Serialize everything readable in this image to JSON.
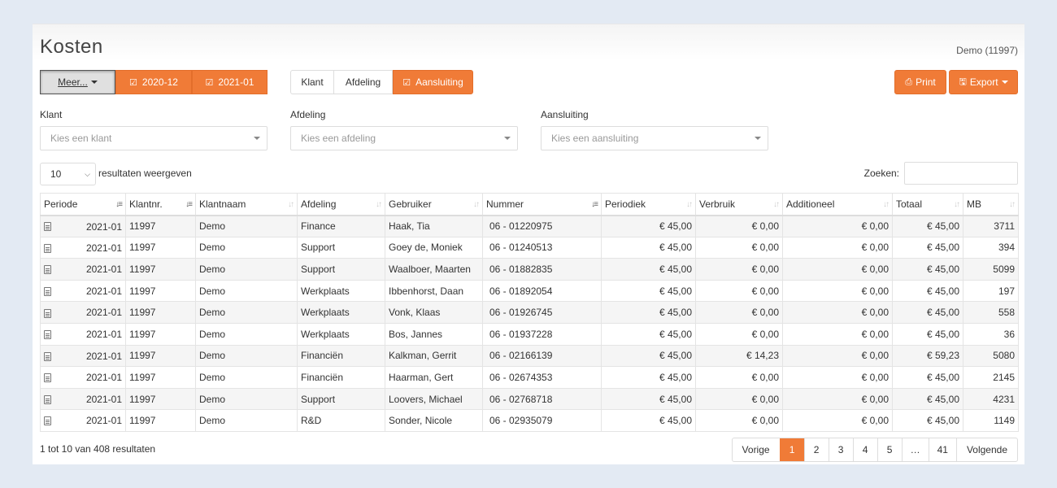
{
  "page": {
    "title": "Kosten",
    "account": "Demo (11997)"
  },
  "toolbar": {
    "more_label": "Meer...",
    "period_buttons": [
      "2020-12",
      "2021-01"
    ],
    "group_buttons": [
      "Klant",
      "Afdeling",
      "Aansluiting"
    ],
    "print_label": "Print",
    "export_label": "Export"
  },
  "filters": {
    "klant": {
      "label": "Klant",
      "placeholder": "Kies een klant"
    },
    "afdeling": {
      "label": "Afdeling",
      "placeholder": "Kies een afdeling"
    },
    "aansluiting": {
      "label": "Aansluiting",
      "placeholder": "Kies een aansluiting"
    }
  },
  "table_controls": {
    "page_length": "10",
    "length_label": "resultaten weergeven",
    "search_label": "Zoeken:"
  },
  "table": {
    "headers": [
      "Periode",
      "Klantnr.",
      "Klantnaam",
      "Afdeling",
      "Gebruiker",
      "Nummer",
      "Periodiek",
      "Verbruik",
      "Additioneel",
      "Totaal",
      "MB"
    ],
    "rows": [
      [
        "2021-01",
        "11997",
        "Demo",
        "Finance",
        "Haak, Tia",
        "06 - 01220975",
        "€ 45,00",
        "€ 0,00",
        "€ 0,00",
        "€ 45,00",
        "3711"
      ],
      [
        "2021-01",
        "11997",
        "Demo",
        "Support",
        "Goey de, Moniek",
        "06 - 01240513",
        "€ 45,00",
        "€ 0,00",
        "€ 0,00",
        "€ 45,00",
        "394"
      ],
      [
        "2021-01",
        "11997",
        "Demo",
        "Support",
        "Waalboer, Maarten",
        "06 - 01882835",
        "€ 45,00",
        "€ 0,00",
        "€ 0,00",
        "€ 45,00",
        "5099"
      ],
      [
        "2021-01",
        "11997",
        "Demo",
        "Werkplaats",
        "Ibbenhorst, Daan",
        "06 - 01892054",
        "€ 45,00",
        "€ 0,00",
        "€ 0,00",
        "€ 45,00",
        "197"
      ],
      [
        "2021-01",
        "11997",
        "Demo",
        "Werkplaats",
        "Vonk, Klaas",
        "06 - 01926745",
        "€ 45,00",
        "€ 0,00",
        "€ 0,00",
        "€ 45,00",
        "558"
      ],
      [
        "2021-01",
        "11997",
        "Demo",
        "Werkplaats",
        "Bos, Jannes",
        "06 - 01937228",
        "€ 45,00",
        "€ 0,00",
        "€ 0,00",
        "€ 45,00",
        "36"
      ],
      [
        "2021-01",
        "11997",
        "Demo",
        "Financiën",
        "Kalkman, Gerrit",
        "06 - 02166139",
        "€ 45,00",
        "€ 14,23",
        "€ 0,00",
        "€ 59,23",
        "5080"
      ],
      [
        "2021-01",
        "11997",
        "Demo",
        "Financiën",
        "Haarman, Gert",
        "06 - 02674353",
        "€ 45,00",
        "€ 0,00",
        "€ 0,00",
        "€ 45,00",
        "2145"
      ],
      [
        "2021-01",
        "11997",
        "Demo",
        "Support",
        "Loovers, Michael",
        "06 - 02768718",
        "€ 45,00",
        "€ 0,00",
        "€ 0,00",
        "€ 45,00",
        "4231"
      ],
      [
        "2021-01",
        "11997",
        "Demo",
        "R&D",
        "Sonder, Nicole",
        "06 - 02935079",
        "€ 45,00",
        "€ 0,00",
        "€ 0,00",
        "€ 45,00",
        "1149"
      ]
    ]
  },
  "footer": {
    "info": "1 tot 10 van 408 resultaten",
    "pagination": {
      "prev": "Vorige",
      "pages": [
        "1",
        "2",
        "3",
        "4",
        "5",
        "…",
        "41"
      ],
      "next": "Volgende"
    }
  },
  "colors": {
    "accent": "#f07b37",
    "background": "#e3eaf3"
  }
}
